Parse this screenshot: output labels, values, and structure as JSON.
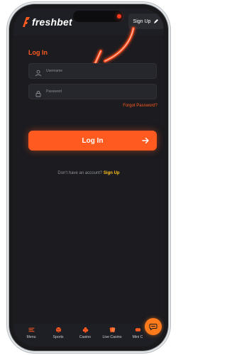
{
  "brand": {
    "name": "freshbet",
    "accent": "#ff5a1f",
    "yellow": "#ffc21a"
  },
  "header": {
    "signup_label": "Sign Up"
  },
  "form": {
    "title": "Log In",
    "username_placeholder": "Username",
    "password_placeholder": "Password",
    "forgot_label": "Forgot Password?",
    "login_label": "Log In",
    "no_account_text": "Don't have an account?",
    "signup_link": "Sign Up"
  },
  "bottom_nav": {
    "items": [
      {
        "label": "Menu",
        "icon": "hamburger-icon"
      },
      {
        "label": "Sports",
        "icon": "ball-icon"
      },
      {
        "label": "Casino",
        "icon": "club-icon"
      },
      {
        "label": "Live Casino",
        "icon": "cards-icon"
      },
      {
        "label": "Mini C",
        "icon": "mini-games-icon"
      }
    ]
  },
  "chat": {
    "icon": "chat-icon"
  }
}
